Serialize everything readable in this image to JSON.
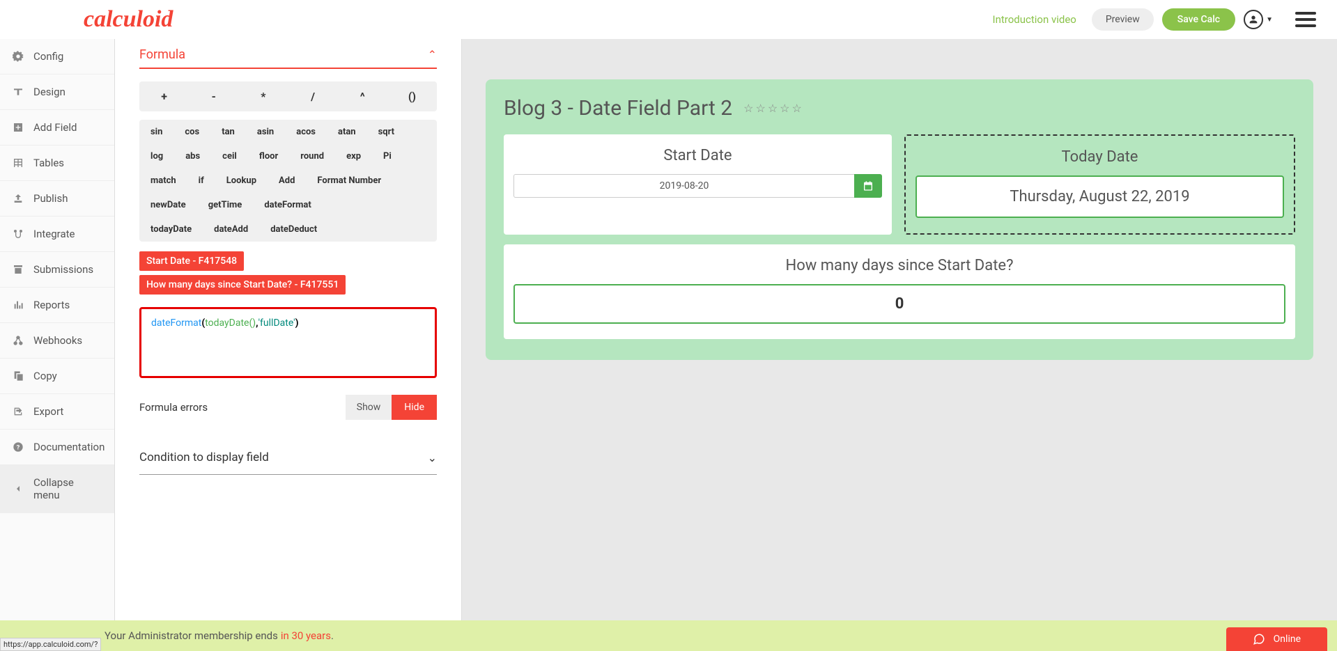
{
  "header": {
    "logo": "calculoid",
    "intro_link": "Introduction video",
    "preview_btn": "Preview",
    "save_btn": "Save Calc"
  },
  "sidebar": {
    "items": [
      {
        "label": "Config",
        "icon": "gear"
      },
      {
        "label": "Design",
        "icon": "text-height"
      },
      {
        "label": "Add Field",
        "icon": "plus-square"
      },
      {
        "label": "Tables",
        "icon": "table"
      },
      {
        "label": "Publish",
        "icon": "upload"
      },
      {
        "label": "Integrate",
        "icon": "branch"
      },
      {
        "label": "Submissions",
        "icon": "archive"
      },
      {
        "label": "Reports",
        "icon": "chart"
      },
      {
        "label": "Webhooks",
        "icon": "hooks"
      },
      {
        "label": "Copy",
        "icon": "copy"
      },
      {
        "label": "Export",
        "icon": "export"
      },
      {
        "label": "Documentation",
        "icon": "question"
      },
      {
        "label": "Collapse menu",
        "icon": "chevron-left"
      }
    ]
  },
  "editor": {
    "formula_title": "Formula",
    "operators": [
      "+",
      "-",
      "*",
      "/",
      "^",
      "()"
    ],
    "functions_r1": [
      "sin",
      "cos",
      "tan",
      "asin",
      "acos",
      "atan"
    ],
    "functions_r2": [
      "sqrt",
      "log",
      "abs",
      "ceil",
      "floor",
      "round"
    ],
    "functions_r3": [
      "exp",
      "Pi",
      "match",
      "if",
      "Lookup",
      "Add"
    ],
    "functions_r4": [
      "Format Number",
      "newDate",
      "getTime",
      "dateFormat"
    ],
    "functions_r5": [
      "todayDate",
      "dateAdd",
      "dateDeduct"
    ],
    "field_refs": [
      "Start Date - F417548",
      "How many days since Start Date? - F417551"
    ],
    "formula_tokens": {
      "t1": "dateFormat",
      "t2": "(",
      "t3": "todayDate()",
      "t4": ",",
      "t5": "'fullDate'",
      "t6": ")"
    },
    "errors_label": "Formula errors",
    "show_btn": "Show",
    "hide_btn": "Hide",
    "condition_title": "Condition to display field"
  },
  "canvas": {
    "title": "Blog 3 - Date Field Part 2",
    "start_date_label": "Start Date",
    "start_date_value": "2019-08-20",
    "today_date_label": "Today Date",
    "today_date_value": "Thursday, August 22, 2019",
    "days_since_label": "How many days since Start Date?",
    "days_since_value": "0"
  },
  "footer": {
    "msg_prefix": "Your Administrator membership ends",
    "msg_highlight": "in 30 years",
    "url_hint": "https://app.calculoid.com/?",
    "online": "Online"
  }
}
